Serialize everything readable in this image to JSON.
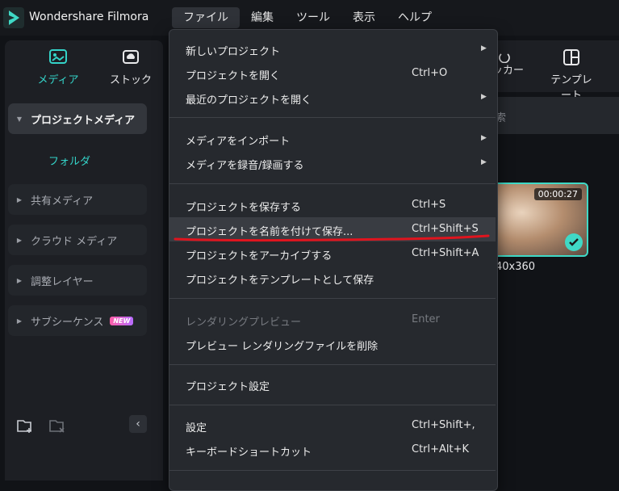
{
  "app": {
    "title": "Wondershare Filmora"
  },
  "menubar": [
    "ファイル",
    "編集",
    "ツール",
    "表示",
    "ヘルプ"
  ],
  "toptabs": {
    "media": "メディア",
    "stock": "ストック",
    "sticker_partial": "ッカー",
    "template": "テンプレート"
  },
  "sidebar": {
    "project_media": "プロジェクトメディア",
    "folder": "フォルダ",
    "shared_media": "共有メディア",
    "cloud_media": "クラウド メディア",
    "adjustment_layer": "調整レイヤー",
    "subsequence": "サブシーケンス",
    "new_badge": "NEW"
  },
  "search": {
    "partial_text": "索"
  },
  "thumbnail": {
    "duration": "00:00:27",
    "label_partial": "40x360"
  },
  "file_menu": {
    "new_project": {
      "label": "新しいプロジェクト"
    },
    "open_project": {
      "label": "プロジェクトを開く",
      "shortcut": "Ctrl+O"
    },
    "recent_projects": {
      "label": "最近のプロジェクトを開く"
    },
    "import_media": {
      "label": "メディアをインポート"
    },
    "record_media": {
      "label": "メディアを録音/録画する"
    },
    "save_project": {
      "label": "プロジェクトを保存する",
      "shortcut": "Ctrl+S"
    },
    "save_as": {
      "label": "プロジェクトを名前を付けて保存...",
      "shortcut": "Ctrl+Shift+S"
    },
    "archive": {
      "label": "プロジェクトをアーカイブする",
      "shortcut": "Ctrl+Shift+A"
    },
    "save_template": {
      "label": "プロジェクトをテンプレートとして保存"
    },
    "render_preview": {
      "label": "レンダリングプレビュー",
      "shortcut": "Enter"
    },
    "delete_render": {
      "label": "プレビュー レンダリングファイルを削除"
    },
    "project_settings": {
      "label": "プロジェクト設定"
    },
    "settings": {
      "label": "設定",
      "shortcut": "Ctrl+Shift+,"
    },
    "keyboard_shortcuts": {
      "label": "キーボードショートカット",
      "shortcut": "Ctrl+Alt+K"
    }
  },
  "colors": {
    "accent": "#34d3c8",
    "annotation": "#e0141e"
  }
}
